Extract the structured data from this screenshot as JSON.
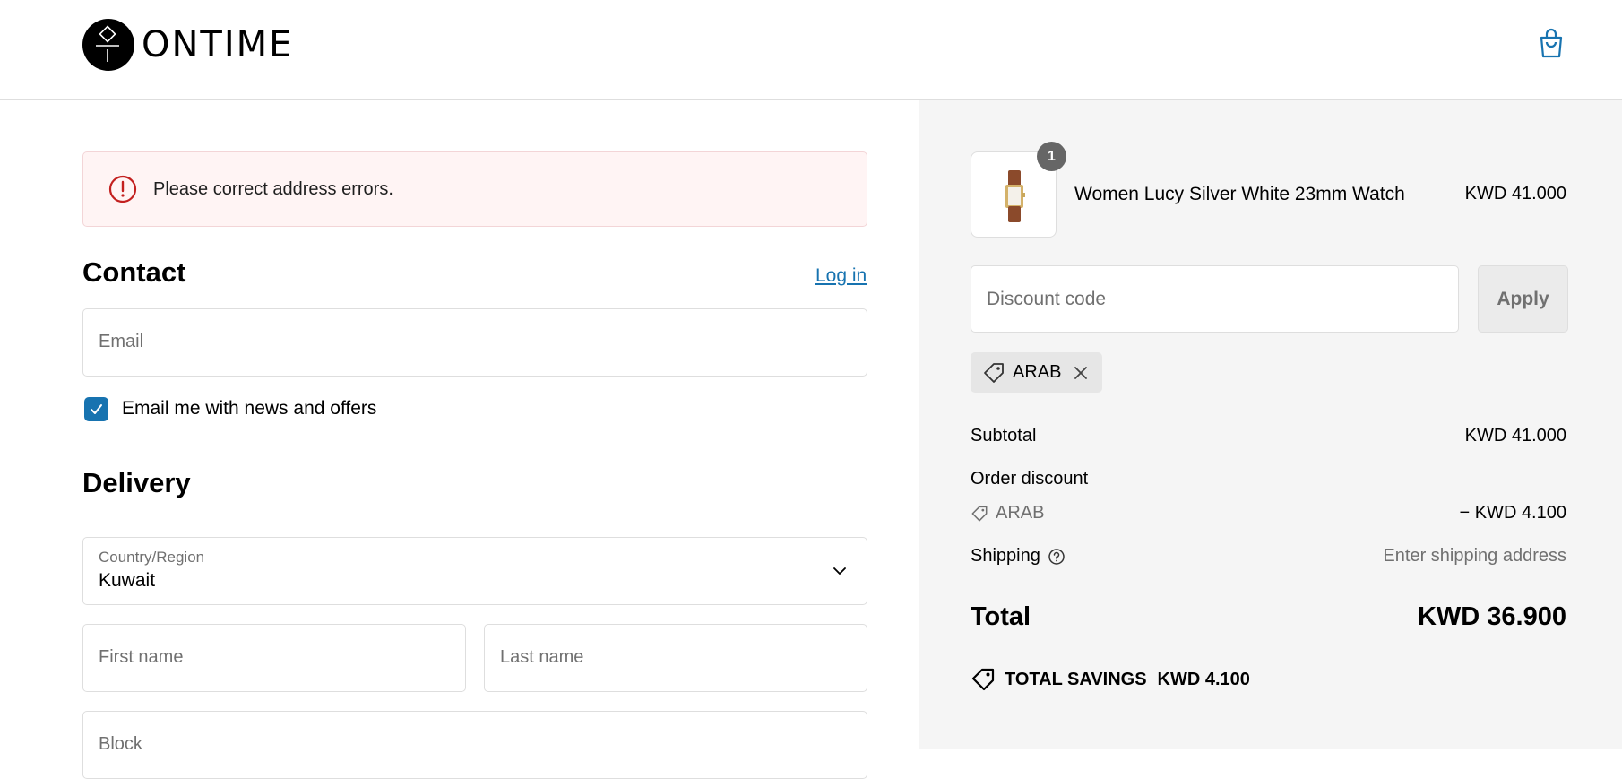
{
  "header": {
    "logo_text": "ONTIME",
    "cart_icon": "shopping-bag-icon"
  },
  "alert": {
    "icon": "error-circle-icon",
    "message": "Please correct address errors."
  },
  "contact": {
    "heading": "Contact",
    "login_link": "Log in",
    "email_placeholder": "Email",
    "news_checkbox_label": "Email me with news and offers",
    "news_checked": true
  },
  "delivery": {
    "heading": "Delivery",
    "country_label": "Country/Region",
    "country_value": "Kuwait",
    "first_name_placeholder": "First name",
    "last_name_placeholder": "Last name",
    "block_placeholder": "Block"
  },
  "summary": {
    "item": {
      "quantity": "1",
      "name": "Women Lucy Silver White 23mm Watch",
      "price": "KWD 41.000"
    },
    "discount_placeholder": "Discount code",
    "apply_label": "Apply",
    "applied_code": "ARAB",
    "subtotal_label": "Subtotal",
    "subtotal_value": "KWD 41.000",
    "order_discount_label": "Order discount",
    "discount_code": "ARAB",
    "discount_value": "− KWD 4.100",
    "shipping_label": "Shipping",
    "shipping_value": "Enter shipping address",
    "total_label": "Total",
    "total_value": "KWD 36.900",
    "savings_label": "TOTAL SAVINGS",
    "savings_value": "KWD 4.100"
  },
  "colors": {
    "accent": "#1773b0",
    "error": "#c3201f",
    "summary_bg": "#f5f5f5"
  }
}
